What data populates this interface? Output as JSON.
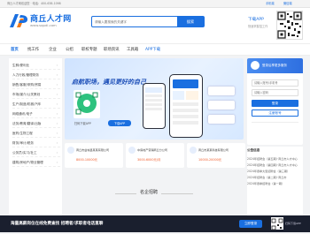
{
  "topbar": {
    "text": "商丘人才网欢迎您 · 电话：400-638-1098",
    "links": [
      "手机端",
      "微信端"
    ]
  },
  "brand": {
    "logo_text": "商丘人才网",
    "url": "www.sqpdi.com",
    "color": "#1a6fe0"
  },
  "search": {
    "placeholder": "请输入要搜索的关键字",
    "button_label": "搜索",
    "download_title": "下载APP",
    "download_sub": "快速掌握招工作"
  },
  "nav": {
    "items": [
      "首页",
      "找工作",
      "企业",
      "公招",
      "职校专题",
      "职场资讯",
      "工具箱",
      "APP下载"
    ]
  },
  "sidebar": {
    "categories": [
      "生鲜/便利业",
      "人力行政/管理财务",
      "销售/客服/采购/贸易",
      "市场/媒介/公关策划",
      "生产/制造/机械/汽车",
      "网络通讯/电子",
      "法务/教育/翻译/出版",
      "医药/生物工程",
      "财务/审计/税务",
      "公务员/实习/社工",
      "建筑/房地产/物业管理"
    ]
  },
  "banner": {
    "headline": "启航职场，遇见更好的自己",
    "qr_caption": "扫码下载APP",
    "app_label": "下载APP"
  },
  "login": {
    "welcome": "登录后享更多服务",
    "username_placeholder": "请输入账号/手机号",
    "password_placeholder": "请输入密码",
    "login_button": "登录",
    "register_button": "注册账号"
  },
  "news": {
    "title": "公告信息",
    "items": [
      "2024年招聘会（第五期）·商丘市人才中心",
      "2024年招聘会（第四期）·商丘市人才中心",
      "2024年春季大型招聘会（第三期）",
      "2024年招聘会（第二期）·商丘市",
      "2024年春季招聘会（第一期）"
    ]
  },
  "cards": [
    {
      "name": "商丘市虞城县某某有限公司",
      "salary": "8000-10000元"
    },
    {
      "name": "中房地产营销商丘分公司",
      "salary": "3000-6000元/月"
    },
    {
      "name": "商丘市某某科技有限公司",
      "salary": "10000-20000元"
    }
  ],
  "section": {
    "title": "名企招聘"
  },
  "footerbar": {
    "text": "海量高薪岗位在线免费查找 招聘者/求职者电话直聊",
    "button": "立即登录",
    "app_text": "扫码下载APP"
  }
}
